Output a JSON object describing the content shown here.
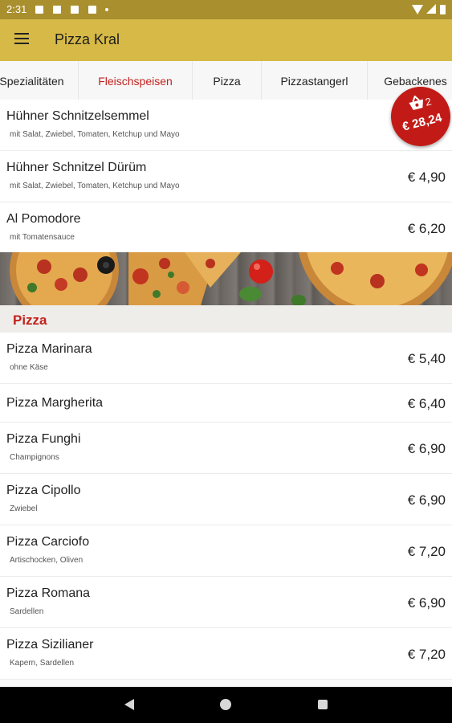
{
  "status_bar": {
    "time": "2:31",
    "icons": [
      "notification-icon",
      "notification-icon",
      "notification-icon",
      "notification-icon",
      "dot-icon",
      "wifi-icon",
      "signal-icon",
      "battery-icon"
    ]
  },
  "app_bar": {
    "title": "Pizza Kral",
    "menu_icon": "hamburger-menu-icon",
    "color": "#d6b946"
  },
  "tabs": [
    {
      "label": "Spezialitäten",
      "active": false
    },
    {
      "label": "Fleischspeisen",
      "active": true
    },
    {
      "label": "Pizza",
      "active": false
    },
    {
      "label": "Pizzastangerl",
      "active": false
    },
    {
      "label": "Gebackenes",
      "active": false
    }
  ],
  "meat_items": [
    {
      "name": "Hühner Schnitzelsemmel",
      "description": "mit Salat, Zwiebel, Tomaten,  Ketchup und Mayo",
      "price": ""
    },
    {
      "name": "Hühner Schnitzel Dürüm",
      "description": "mit Salat, Zwiebel, Tomaten,  Ketchup und Mayo",
      "price": "€ 4,90"
    },
    {
      "name": "Al Pomodore",
      "description": "mit Tomatensauce",
      "price": "€ 6,20"
    }
  ],
  "pizza_section": {
    "title": "Pizza",
    "items": [
      {
        "name": "Pizza Marinara",
        "description": "ohne Käse",
        "price": "€ 5,40"
      },
      {
        "name": "Pizza Margherita",
        "description": "",
        "price": "€ 6,40"
      },
      {
        "name": "Pizza Funghi",
        "description": "Champignons",
        "price": "€ 6,90"
      },
      {
        "name": "Pizza Cipollo",
        "description": "Zwiebel",
        "price": "€ 6,90"
      },
      {
        "name": "Pizza Carciofo",
        "description": "Artischocken, Oliven",
        "price": "€ 7,20"
      },
      {
        "name": "Pizza Romana",
        "description": "Sardellen",
        "price": "€ 6,90"
      },
      {
        "name": "Pizza Sizilianer",
        "description": "Kapern, Sardellen",
        "price": "€ 7,20"
      }
    ]
  },
  "cart": {
    "icon": "shopping-basket-icon",
    "count": "2",
    "total": "€ 28,24",
    "color": "#c21b17"
  },
  "colors": {
    "accent": "#c0221d",
    "status_bar": "#a98f2e"
  },
  "nav_bar": {
    "icons": [
      "back-icon",
      "home-icon",
      "recents-icon"
    ]
  }
}
